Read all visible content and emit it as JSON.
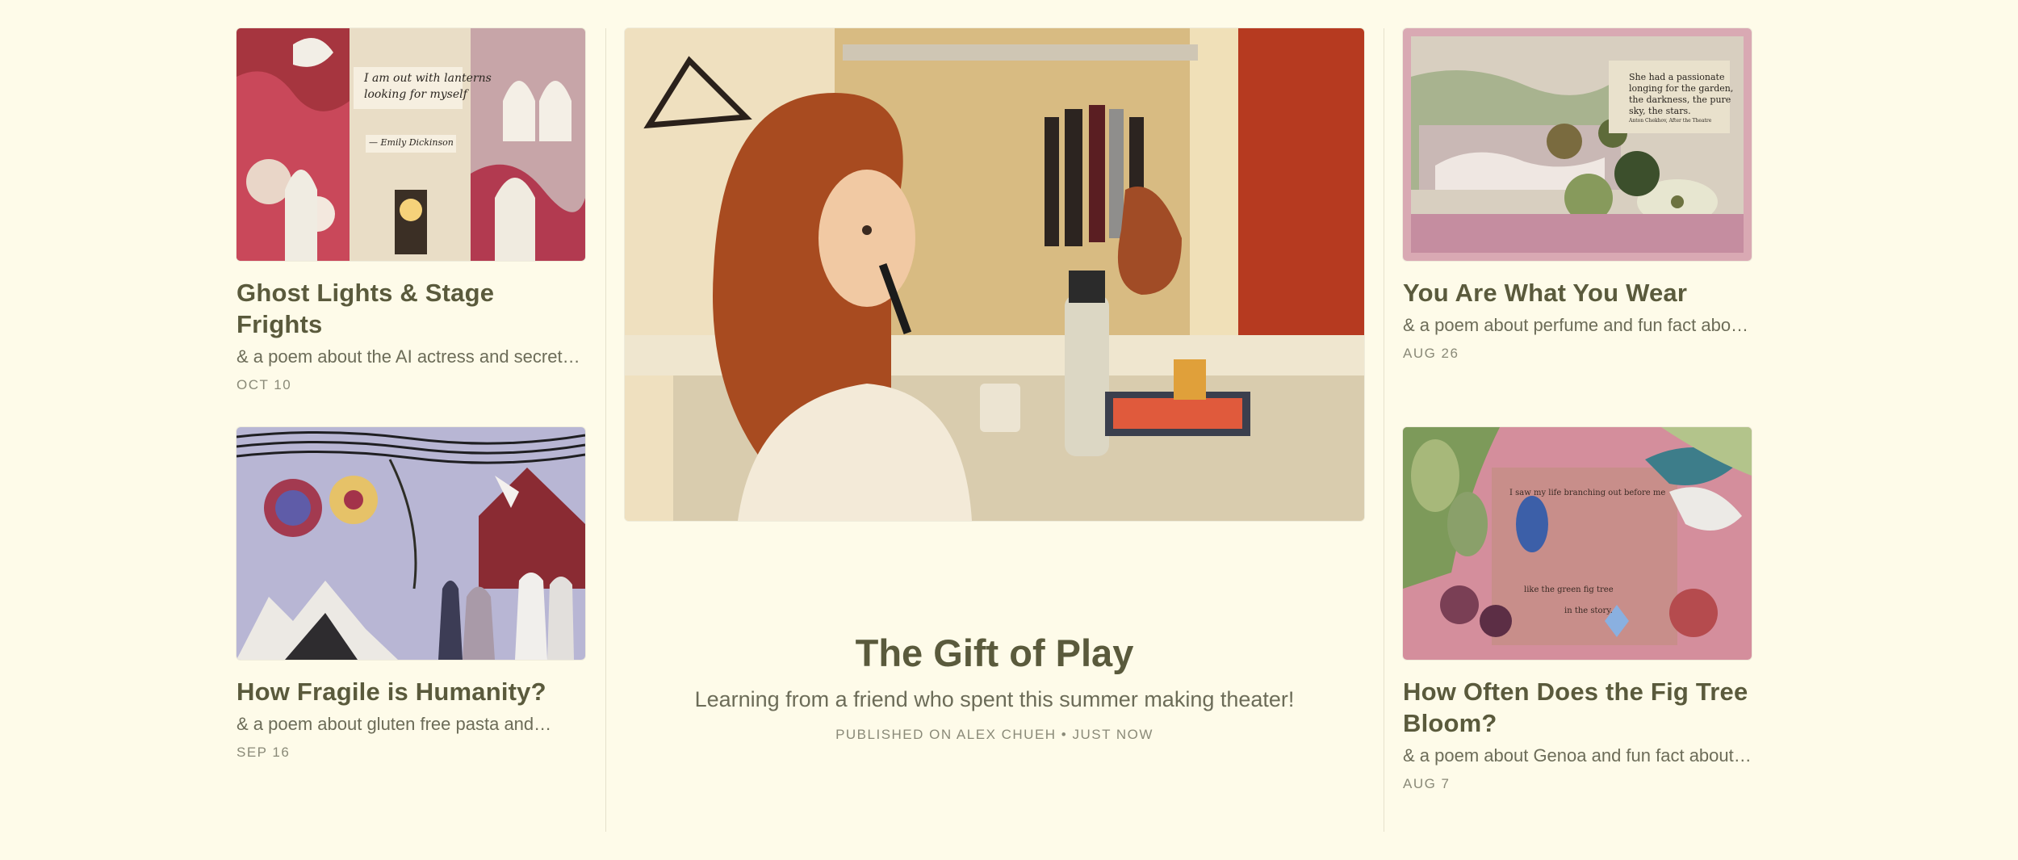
{
  "posts": {
    "ghost_lights": {
      "title": "Ghost Lights & Stage Frights",
      "subtitle": "& a poem about the AI actress and secret…",
      "date": "OCT 10",
      "image_quote_line1": "I am out with lanterns",
      "image_quote_line2": "looking for myself",
      "image_attribution": "— Emily Dickinson"
    },
    "fragile_humanity": {
      "title": "How Fragile is Humanity?",
      "subtitle": "& a poem about gluten free pasta and…",
      "date": "SEP 16"
    },
    "what_you_wear": {
      "title": "You Are What You Wear",
      "subtitle": "& a poem about perfume and fun fact abo…",
      "date": "AUG 26",
      "image_quote_line1": "She had a passionate",
      "image_quote_line2": "longing for the garden,",
      "image_quote_line3": "the darkness, the pure",
      "image_quote_line4": "sky, the stars.",
      "image_attribution": "Anton Chekhov, After the Theatre"
    },
    "fig_tree": {
      "title_line1": "How Often Does the Fig Tree",
      "title_line2": "Bloom?",
      "subtitle": "& a poem about Genoa and fun fact about…",
      "date": "AUG 7",
      "image_text1": "I saw my life branching out before me",
      "image_text2": "like the green fig tree",
      "image_text3": "in the story."
    }
  },
  "featured": {
    "title": "The Gift of Play",
    "subtitle": "Learning from a friend who spent this summer making theater!",
    "meta": "PUBLISHED ON ALEX CHUEH • JUST NOW"
  },
  "colors": {
    "background": "#fefbe9",
    "title": "#5a5a3c",
    "divider": "#e6e1cc"
  }
}
